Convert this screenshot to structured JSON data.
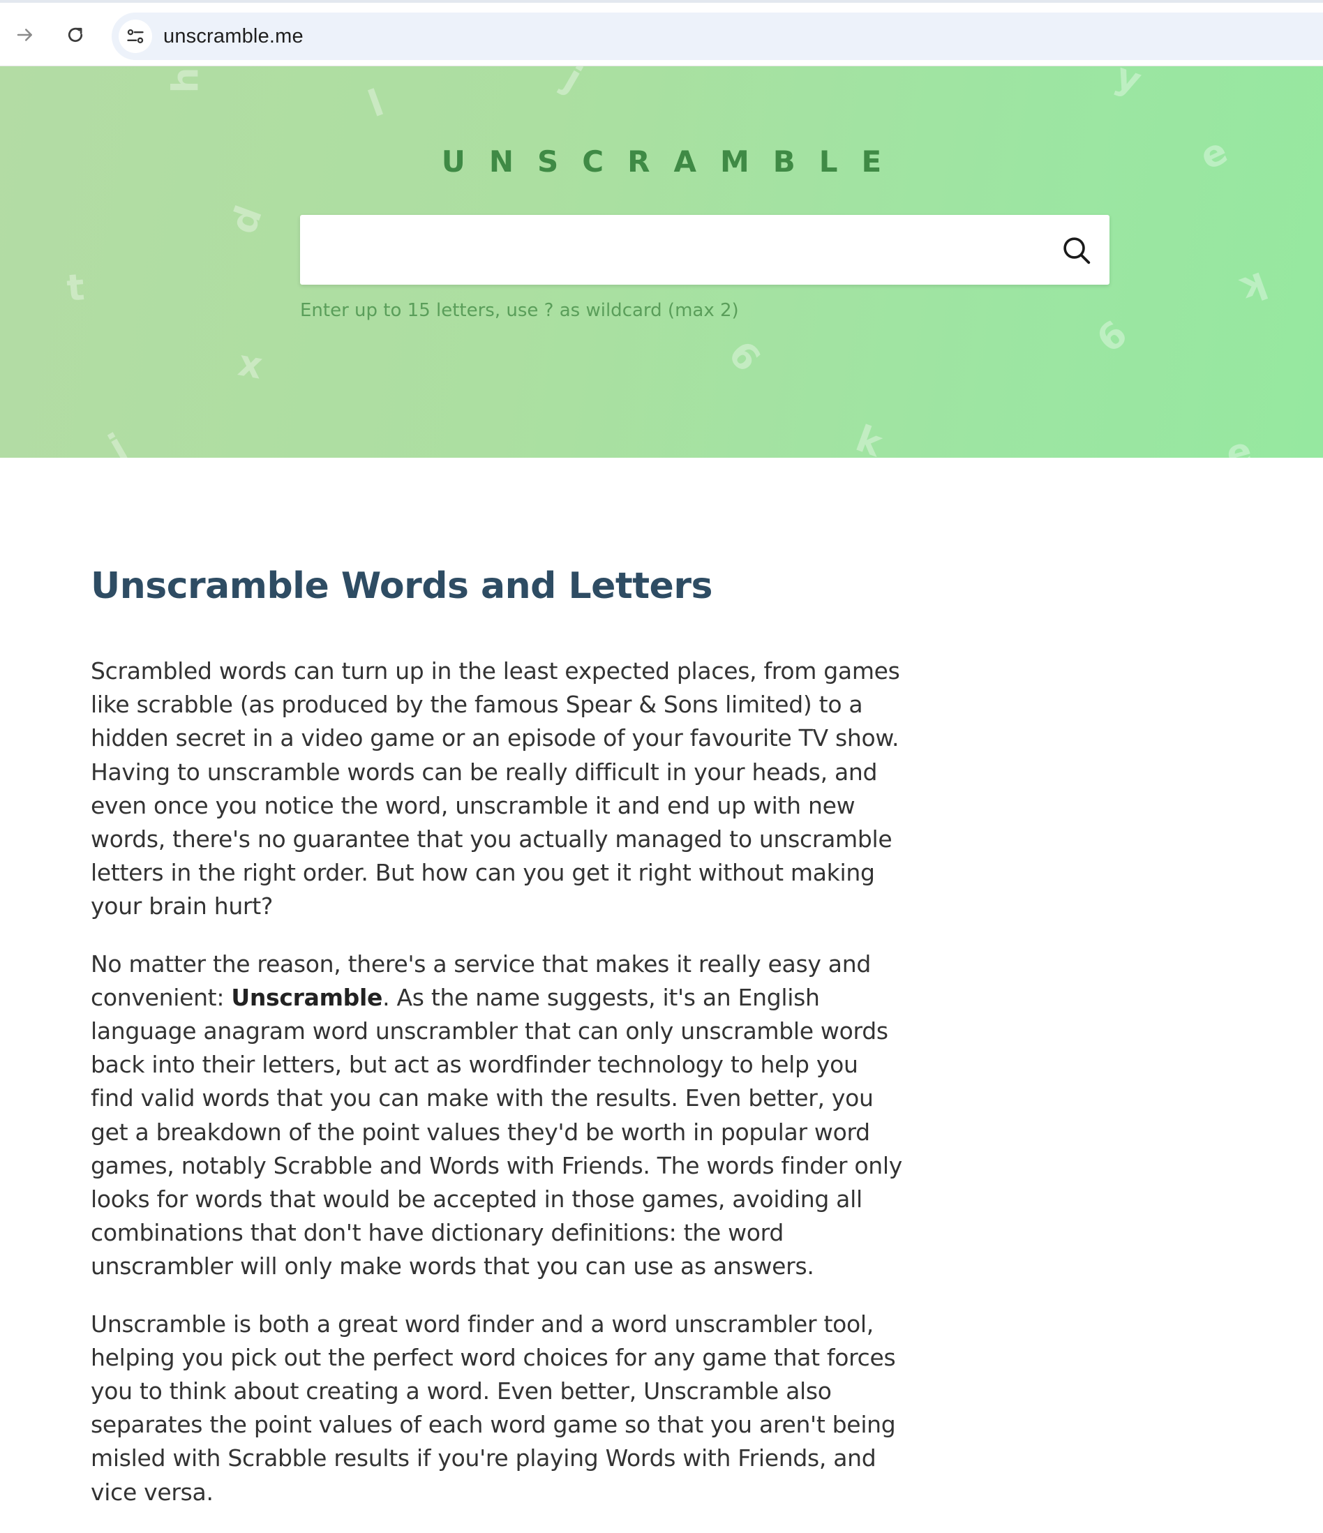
{
  "browser": {
    "url": "unscramble.me",
    "icons": {
      "back": "arrow-forward-icon",
      "reload": "reload-icon",
      "site_info": "tune-icon"
    }
  },
  "hero": {
    "logo": "UNSCRAMBLE",
    "search_placeholder": "",
    "search_value": "",
    "search_icon": "search-icon",
    "hint": "Enter up to 15 letters, use ? as wildcard (max 2)",
    "colors": {
      "background_start": "#b3dca4",
      "background_end": "#96e8a0",
      "logo": "#3f8a45",
      "hint": "#5a9e5a"
    },
    "background_letters": [
      "h",
      "l",
      "j",
      "y",
      "e",
      "p",
      "t",
      "k",
      "6",
      "x",
      "6",
      "j",
      "k",
      "e"
    ]
  },
  "article": {
    "title": "Unscramble Words and Letters",
    "paragraphs": [
      "Scrambled words can turn up in the least expected places, from games like scrabble (as produced by the famous Spear & Sons limited) to a hidden secret in a video game or an episode of your favourite TV show. Having to unscramble words can be really difficult in your heads, and even once you notice the word, unscramble it and end up with new words, there's no guarantee that you actually managed to unscramble letters in the right order. But how can you get it right without making your brain hurt?",
      {
        "before": "No matter the reason, there's a service that makes it really easy and convenient: ",
        "bold": "Unscramble",
        "after": ". As the name suggests, it's an English language anagram word unscrambler that can only unscramble words back into their letters, but act as wordfinder technology to help you find valid words that you can make with the results. Even better, you get a breakdown of the point values they'd be worth in popular word games, notably Scrabble and Words with Friends. The words finder only looks for words that would be accepted in those games, avoiding all combinations that don't have dictionary definitions: the word unscrambler will only make words that you can use as answers."
      },
      "Unscramble is both a great word finder and a word unscrambler tool, helping you pick out the perfect word choices for any game that forces you to think about creating a word. Even better, Unscramble also separates the point values of each word game so that you aren't being misled with Scrabble results if you're playing Words with Friends, and vice versa."
    ],
    "colors": {
      "title": "#2e4c63",
      "text": "#333333"
    }
  }
}
